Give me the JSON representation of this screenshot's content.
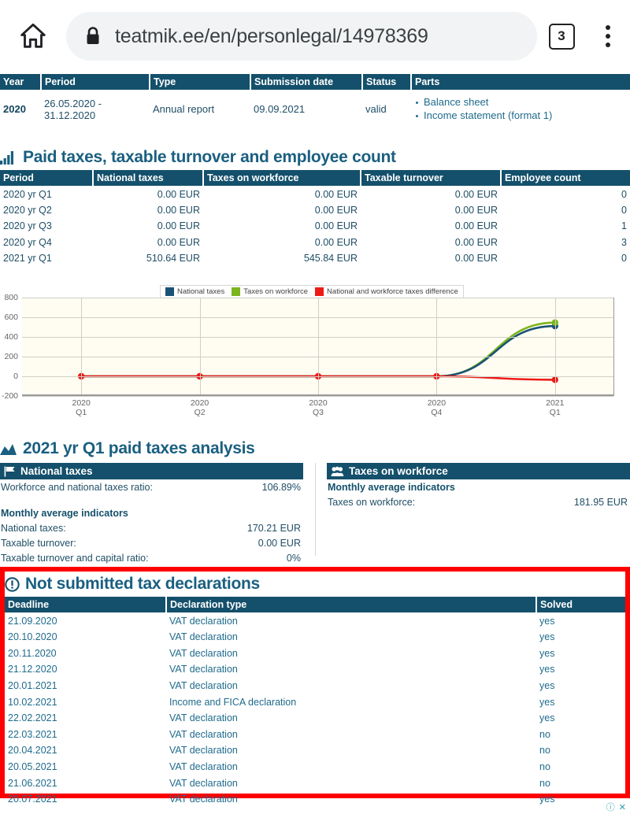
{
  "browser": {
    "home_icon": "home-icon",
    "lock_icon": "lock-icon",
    "url": "teatmik.ee/en/personlegal/14978369",
    "tab_count": "3",
    "menu_icon": "overflow-menu-icon"
  },
  "reports": {
    "columns": [
      "Year",
      "Period",
      "Type",
      "Submission date",
      "Status",
      "Parts"
    ],
    "rows": [
      {
        "year": "2020",
        "period": "26.05.2020 - 31.12.2020",
        "type": "Annual report",
        "submission_date": "09.09.2021",
        "status": "valid",
        "parts": [
          "Balance sheet",
          "Income statement (format 1)"
        ]
      }
    ]
  },
  "paid_taxes": {
    "icon": "bar-chart-icon",
    "title": "Paid taxes, taxable turnover and employee count",
    "columns": [
      "Period",
      "National taxes",
      "Taxes on workforce",
      "Taxable turnover",
      "Employee count"
    ],
    "rows": [
      {
        "period": "2020 yr Q1",
        "national_taxes": "0.00 EUR",
        "workforce_taxes": "0.00 EUR",
        "taxable_turnover": "0.00 EUR",
        "employee_count": "0"
      },
      {
        "period": "2020 yr Q2",
        "national_taxes": "0.00 EUR",
        "workforce_taxes": "0.00 EUR",
        "taxable_turnover": "0.00 EUR",
        "employee_count": "0"
      },
      {
        "period": "2020 yr Q3",
        "national_taxes": "0.00 EUR",
        "workforce_taxes": "0.00 EUR",
        "taxable_turnover": "0.00 EUR",
        "employee_count": "1"
      },
      {
        "period": "2020 yr Q4",
        "national_taxes": "0.00 EUR",
        "workforce_taxes": "0.00 EUR",
        "taxable_turnover": "0.00 EUR",
        "employee_count": "3"
      },
      {
        "period": "2021 yr Q1",
        "national_taxes": "510.64 EUR",
        "workforce_taxes": "545.84 EUR",
        "taxable_turnover": "0.00 EUR",
        "employee_count": "0"
      }
    ]
  },
  "chart_data": {
    "type": "line",
    "title": "",
    "xlabel": "",
    "ylabel": "",
    "grid": true,
    "legend_position": "top-center",
    "categories": [
      "2020 Q1",
      "2020 Q2",
      "2020 Q3",
      "2020 Q4",
      "2021 Q1"
    ],
    "category_lines": [
      [
        "2020",
        "Q1"
      ],
      [
        "2020",
        "Q2"
      ],
      [
        "2020",
        "Q3"
      ],
      [
        "2020",
        "Q4"
      ],
      [
        "2021",
        "Q1"
      ]
    ],
    "ylim": [
      -200,
      800
    ],
    "yticks": [
      "800",
      "600",
      "400",
      "200",
      "0",
      "-200"
    ],
    "ytick_values": [
      800,
      600,
      400,
      200,
      0,
      -200
    ],
    "series": [
      {
        "name": "National taxes",
        "color": "#1a5276",
        "values": [
          0,
          0,
          0,
          0,
          510.64
        ]
      },
      {
        "name": "Taxes on workforce",
        "color": "#7db51e",
        "values": [
          0,
          0,
          0,
          0,
          545.84
        ]
      },
      {
        "name": "National and workforce taxes difference",
        "color": "#ee1b17",
        "values": [
          0,
          0,
          0,
          0,
          -35.2
        ]
      }
    ]
  },
  "analysis": {
    "icon": "area-chart-icon",
    "title": "2021 yr Q1 paid taxes analysis",
    "national": {
      "icon": "flag-icon",
      "header": "National taxes",
      "ratio_label": "Workforce and national taxes ratio:",
      "ratio_value": "106.89%",
      "monthly_label": "Monthly average indicators",
      "items": [
        {
          "label": "National taxes:",
          "value": "170.21 EUR"
        },
        {
          "label": "Taxable turnover:",
          "value": "0.00 EUR"
        },
        {
          "label": "Taxable turnover and capital ratio:",
          "value": "0%"
        }
      ]
    },
    "workforce": {
      "icon": "users-icon",
      "header": "Taxes on workforce",
      "monthly_label": "Monthly average indicators",
      "items": [
        {
          "label": "Taxes on workforce:",
          "value": "181.95 EUR"
        }
      ]
    }
  },
  "not_submitted": {
    "icon": "exclamation-circle-icon",
    "title": "Not submitted tax declarations",
    "highlight_color": "#fe0000",
    "columns": [
      "Deadline",
      "Declaration type",
      "Solved"
    ],
    "rows": [
      {
        "deadline": "21.09.2020",
        "type": "VAT declaration",
        "solved": "yes"
      },
      {
        "deadline": "20.10.2020",
        "type": "VAT declaration",
        "solved": "yes"
      },
      {
        "deadline": "20.11.2020",
        "type": "VAT declaration",
        "solved": "yes"
      },
      {
        "deadline": "21.12.2020",
        "type": "VAT declaration",
        "solved": "yes"
      },
      {
        "deadline": "20.01.2021",
        "type": "VAT declaration",
        "solved": "yes"
      },
      {
        "deadline": "10.02.2021",
        "type": "Income and FICA declaration",
        "solved": "yes"
      },
      {
        "deadline": "22.02.2021",
        "type": "VAT declaration",
        "solved": "yes"
      },
      {
        "deadline": "22.03.2021",
        "type": "VAT declaration",
        "solved": "no"
      },
      {
        "deadline": "20.04.2021",
        "type": "VAT declaration",
        "solved": "no"
      },
      {
        "deadline": "20.05.2021",
        "type": "VAT declaration",
        "solved": "no"
      },
      {
        "deadline": "21.06.2021",
        "type": "VAT declaration",
        "solved": "no"
      },
      {
        "deadline": "20.07.2021",
        "type": "VAT declaration",
        "solved": "yes"
      }
    ]
  },
  "footer_glyphs": "ⓘ ✕"
}
